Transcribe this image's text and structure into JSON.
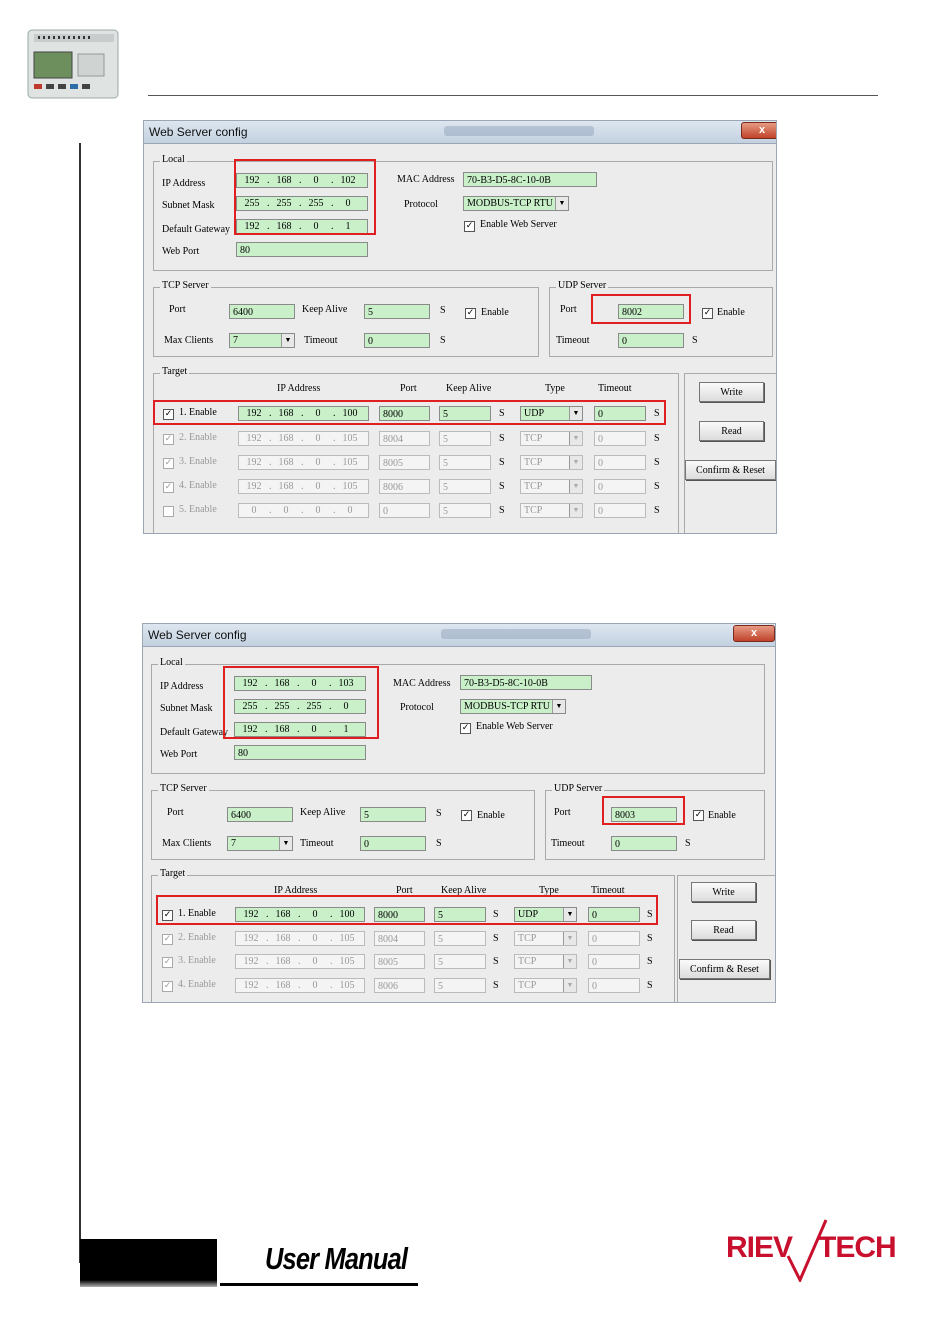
{
  "dialog1": {
    "title": "Web Server config",
    "close_label": "x",
    "local_label": "Local",
    "ip_label": "IP Address",
    "mask_label": "Subnet Mask",
    "gateway_label": "Default Gateway",
    "webport_label": "Web Port",
    "mac_label": "MAC Address",
    "protocol_label": "Protocol",
    "enable_web_label": "Enable Web Server",
    "ip": [
      "192",
      "168",
      "0",
      "102"
    ],
    "mask": [
      "255",
      "255",
      "255",
      "0"
    ],
    "gateway": [
      "192",
      "168",
      "0",
      "1"
    ],
    "web_port": "80",
    "mac": "70-B3-D5-8C-10-0B",
    "protocol": "MODBUS-TCP RTU",
    "tcp_label": "TCP Server",
    "port_label": "Port",
    "keepalive_label": "Keep Alive",
    "maxclients_label": "Max Clients",
    "timeout_label": "Timeout",
    "enable_label": "Enable",
    "s_unit": "S",
    "tcp_port": "6400",
    "tcp_keepalive": "5",
    "max_clients": "7",
    "tcp_timeout": "0",
    "udp_label": "UDP Server",
    "udp_port": "8002",
    "udp_timeout": "0",
    "target_label": "Target",
    "col_ip": "IP Address",
    "col_port": "Port",
    "col_keepalive": "Keep Alive",
    "col_type": "Type",
    "col_timeout": "Timeout",
    "targets": [
      {
        "label": "1. Enable",
        "ip": [
          "192",
          "168",
          "0",
          "100"
        ],
        "port": "8000",
        "keepalive": "5",
        "type": "UDP",
        "timeout": "0"
      },
      {
        "label": "2. Enable",
        "ip": [
          "192",
          "168",
          "0",
          "105"
        ],
        "port": "8004",
        "keepalive": "5",
        "type": "TCP",
        "timeout": "0"
      },
      {
        "label": "3. Enable",
        "ip": [
          "192",
          "168",
          "0",
          "105"
        ],
        "port": "8005",
        "keepalive": "5",
        "type": "TCP",
        "timeout": "0"
      },
      {
        "label": "4. Enable",
        "ip": [
          "192",
          "168",
          "0",
          "105"
        ],
        "port": "8006",
        "keepalive": "5",
        "type": "TCP",
        "timeout": "0"
      },
      {
        "label": "5. Enable",
        "ip": [
          "0",
          "0",
          "0",
          "0"
        ],
        "port": "0",
        "keepalive": "5",
        "type": "TCP",
        "timeout": "0"
      }
    ],
    "write_label": "Write",
    "read_label": "Read",
    "confirm_label": "Confirm & Reset"
  },
  "dialog2": {
    "title": "Web Server config",
    "close_label": "x",
    "local_label": "Local",
    "ip_label": "IP Address",
    "mask_label": "Subnet Mask",
    "gateway_label": "Default Gateway",
    "webport_label": "Web Port",
    "mac_label": "MAC Address",
    "protocol_label": "Protocol",
    "enable_web_label": "Enable Web Server",
    "ip": [
      "192",
      "168",
      "0",
      "103"
    ],
    "mask": [
      "255",
      "255",
      "255",
      "0"
    ],
    "gateway": [
      "192",
      "168",
      "0",
      "1"
    ],
    "web_port": "80",
    "mac": "70-B3-D5-8C-10-0B",
    "protocol": "MODBUS-TCP RTU",
    "tcp_label": "TCP Server",
    "port_label": "Port",
    "keepalive_label": "Keep Alive",
    "maxclients_label": "Max Clients",
    "timeout_label": "Timeout",
    "enable_label": "Enable",
    "s_unit": "S",
    "tcp_port": "6400",
    "tcp_keepalive": "5",
    "max_clients": "7",
    "tcp_timeout": "0",
    "udp_label": "UDP Server",
    "udp_port": "8003",
    "udp_timeout": "0",
    "target_label": "Target",
    "col_ip": "IP Address",
    "col_port": "Port",
    "col_keepalive": "Keep Alive",
    "col_type": "Type",
    "col_timeout": "Timeout",
    "targets": [
      {
        "label": "1. Enable",
        "ip": [
          "192",
          "168",
          "0",
          "100"
        ],
        "port": "8000",
        "keepalive": "5",
        "type": "UDP",
        "timeout": "0"
      },
      {
        "label": "2. Enable",
        "ip": [
          "192",
          "168",
          "0",
          "105"
        ],
        "port": "8004",
        "keepalive": "5",
        "type": "TCP",
        "timeout": "0"
      },
      {
        "label": "3. Enable",
        "ip": [
          "192",
          "168",
          "0",
          "105"
        ],
        "port": "8005",
        "keepalive": "5",
        "type": "TCP",
        "timeout": "0"
      },
      {
        "label": "4. Enable",
        "ip": [
          "192",
          "168",
          "0",
          "105"
        ],
        "port": "8006",
        "keepalive": "5",
        "type": "TCP",
        "timeout": "0"
      }
    ],
    "write_label": "Write",
    "read_label": "Read",
    "confirm_label": "Confirm & Reset"
  },
  "footer": {
    "manual_label": "User Manual",
    "brand_left": "RIEV",
    "brand_right": "TECH"
  },
  "colors": {
    "field_green": "#c9f0c9",
    "highlight_red": "#e02020",
    "brand_red": "#c8102e"
  }
}
